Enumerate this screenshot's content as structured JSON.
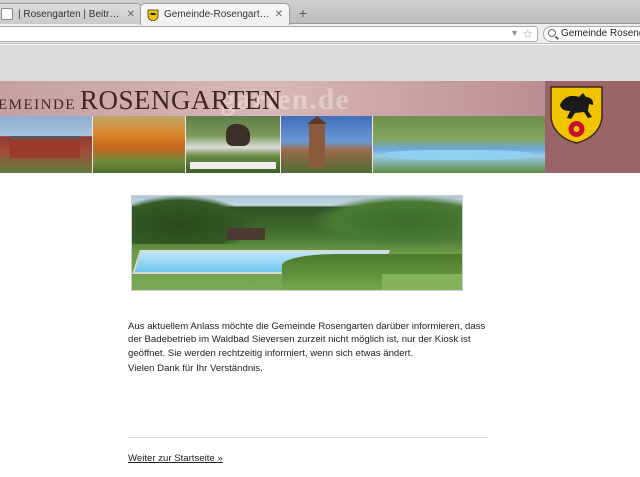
{
  "browser": {
    "tabs": [
      {
        "label": "| Rosengarten | Beitrag be...",
        "active": false
      },
      {
        "label": "Gemeinde-Rosengarten.de",
        "active": true
      }
    ],
    "close_glyph": "✕",
    "new_tab_glyph": "+",
    "search_value": "Gemeinde Rosengarten"
  },
  "banner": {
    "brand_small": "EMEINDE",
    "brand_big": "ROSENGARTEN",
    "watermark": "garten.de",
    "photos": [
      "town-hall",
      "autumn-trees",
      "show-jumping",
      "church-tower",
      "outdoor-pool"
    ]
  },
  "content": {
    "photo_alt": "Waldbad Sieversen",
    "message": "Aus aktuellem Anlass möchte die Gemeinde Rosengarten darüber informieren, dass der Badebetrieb im Waldbad Sieversen zurzeit nicht möglich ist, nur der Kiosk ist geöffnet. Sie werden rechtzeitig informiert, wenn sich etwas ändert.",
    "thanks": "Vielen Dank für Ihr Verständnis.",
    "home_link": "Weiter zur Startseite »"
  },
  "colors": {
    "banner": "#b98a8e",
    "crest_yellow": "#f2c400",
    "crest_red": "#c8102e"
  }
}
